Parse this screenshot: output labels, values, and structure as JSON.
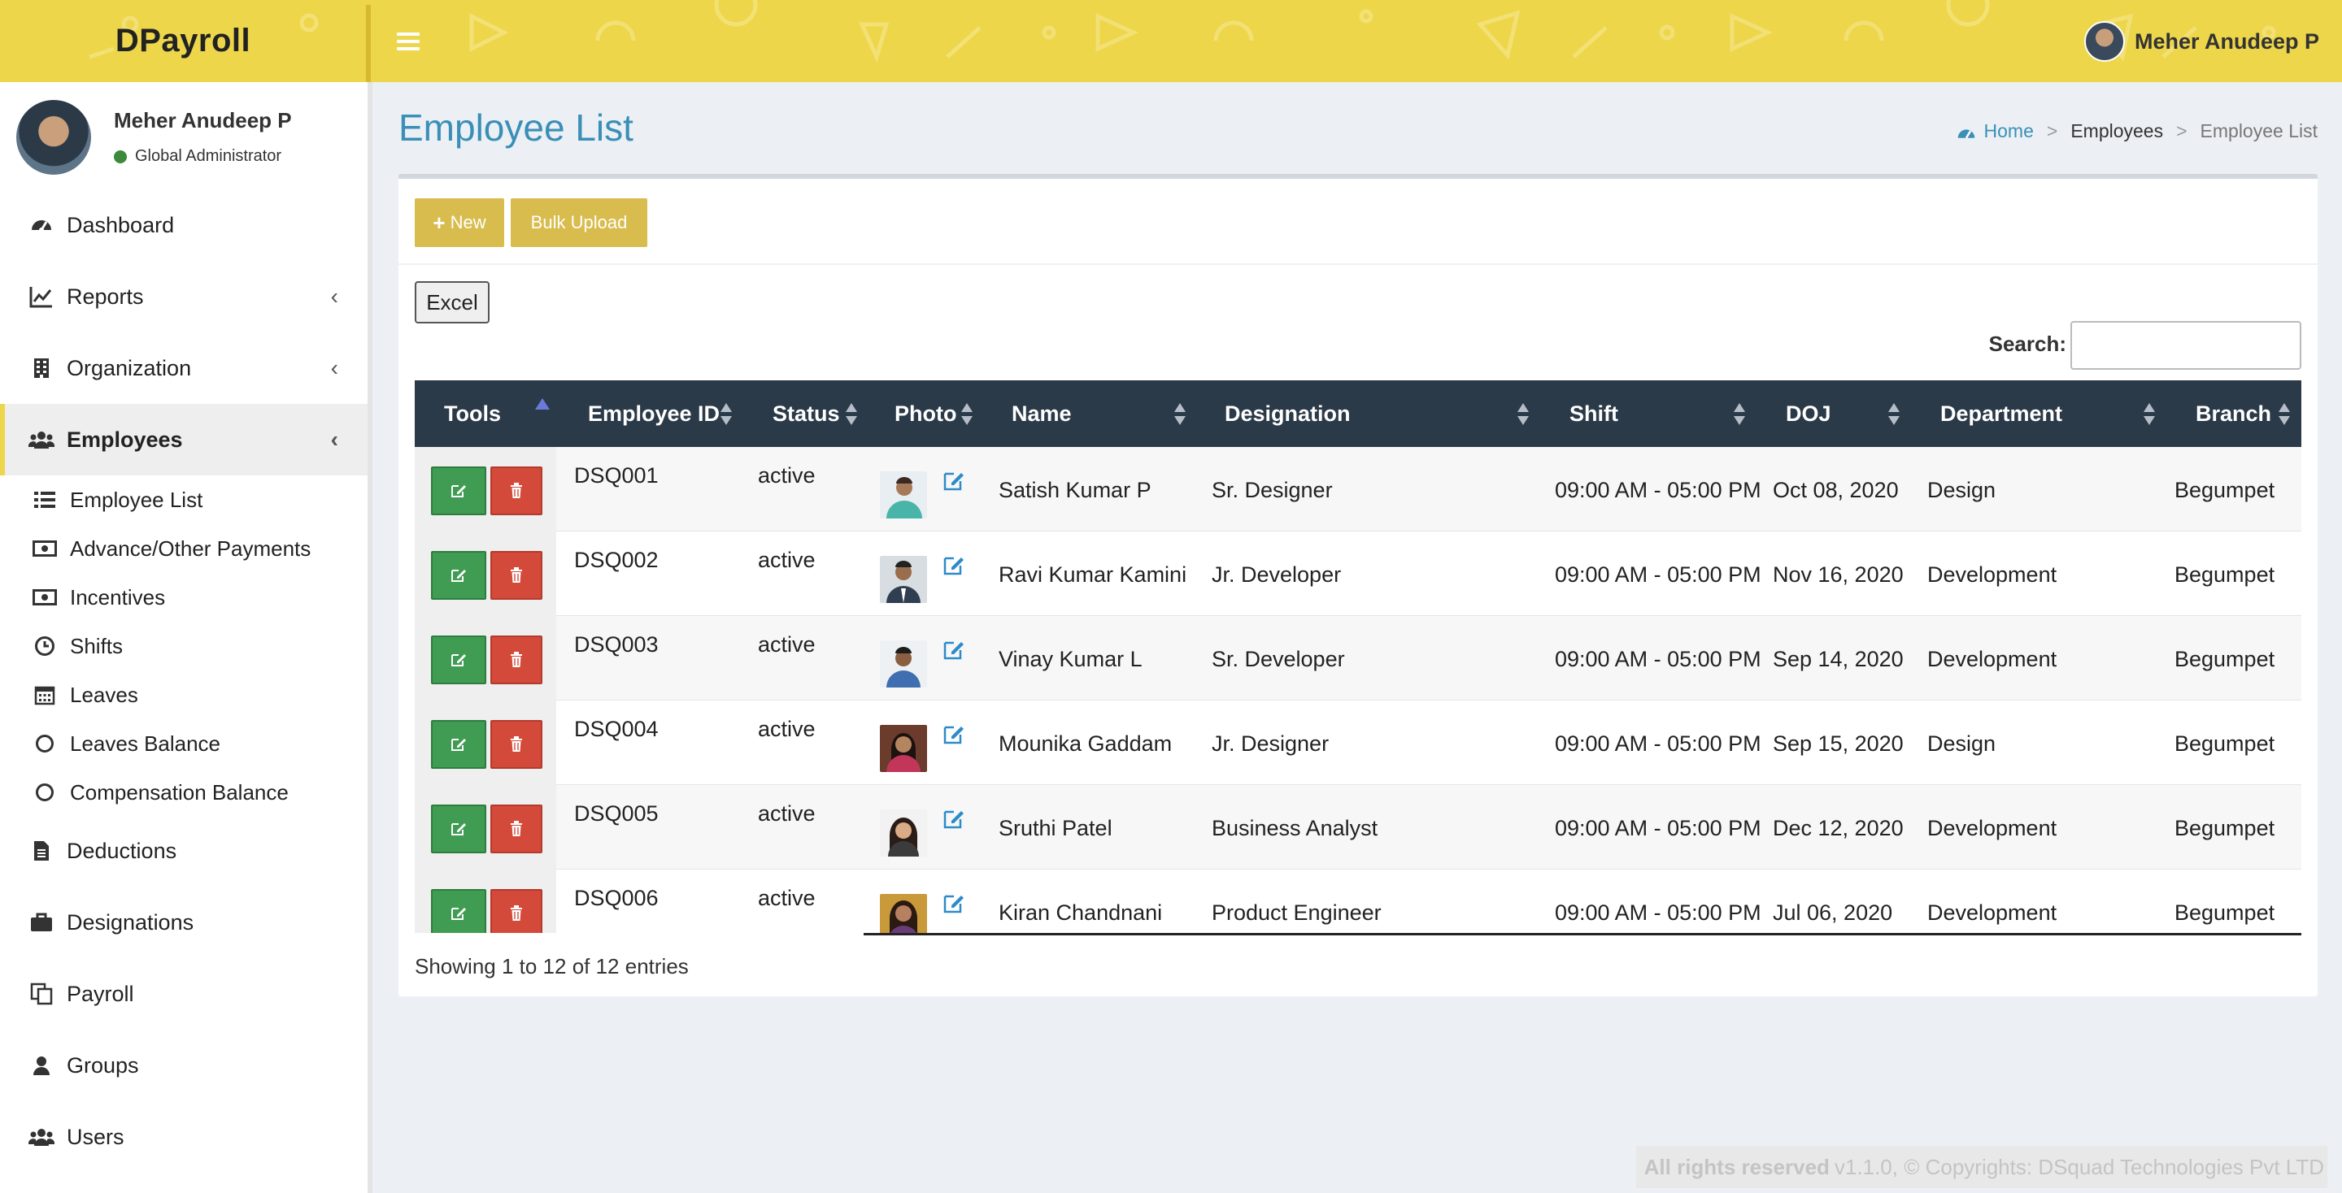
{
  "header": {
    "logo": "DPayroll",
    "user_name": "Meher Anudeep P"
  },
  "sidebar": {
    "profile": {
      "name": "Meher Anudeep P",
      "role": "Global Administrator",
      "status_color": "#3c8a3c"
    },
    "items": [
      {
        "label": "Dashboard",
        "icon": "dashboard-icon"
      },
      {
        "label": "Reports",
        "icon": "line-chart-icon"
      },
      {
        "label": "Organization",
        "icon": "building-icon"
      },
      {
        "label": "Employees",
        "icon": "users-icon"
      },
      {
        "label": "Deductions",
        "icon": "file-icon"
      },
      {
        "label": "Designations",
        "icon": "briefcase-icon"
      },
      {
        "label": "Payroll",
        "icon": "copy-icon"
      },
      {
        "label": "Groups",
        "icon": "user-icon"
      },
      {
        "label": "Users",
        "icon": "users-icon"
      }
    ],
    "sub_items": [
      {
        "label": "Employee List",
        "icon": "list-icon"
      },
      {
        "label": "Advance/Other Payments",
        "icon": "money-icon"
      },
      {
        "label": "Incentives",
        "icon": "money-icon"
      },
      {
        "label": "Shifts",
        "icon": "clock-icon"
      },
      {
        "label": "Leaves",
        "icon": "calendar-icon"
      },
      {
        "label": "Leaves Balance",
        "icon": "circle-icon"
      },
      {
        "label": "Compensation Balance",
        "icon": "circle-icon"
      }
    ]
  },
  "page": {
    "title": "Employee List",
    "breadcrumb": {
      "home": "Home",
      "section": "Employees",
      "current": "Employee List"
    }
  },
  "toolbar": {
    "new_label": "New",
    "bulk_upload_label": "Bulk Upload",
    "excel_label": "Excel",
    "search_label": "Search:",
    "search_value": ""
  },
  "table": {
    "columns": [
      "Tools",
      "Employee ID",
      "Status",
      "Photo",
      "Name",
      "Designation",
      "Shift",
      "DOJ",
      "Department",
      "Branch"
    ],
    "rows": [
      {
        "id": "DSQ001",
        "status": "active",
        "name": "Satish Kumar P",
        "designation": "Sr. Designer",
        "shift": "09:00 AM - 05:00 PM",
        "doj": "Oct 08, 2020",
        "department": "Design",
        "branch": "Begumpet"
      },
      {
        "id": "DSQ002",
        "status": "active",
        "name": "Ravi Kumar Kamini",
        "designation": "Jr. Developer",
        "shift": "09:00 AM - 05:00 PM",
        "doj": "Nov 16, 2020",
        "department": "Development",
        "branch": "Begumpet"
      },
      {
        "id": "DSQ003",
        "status": "active",
        "name": "Vinay Kumar L",
        "designation": "Sr. Developer",
        "shift": "09:00 AM - 05:00 PM",
        "doj": "Sep 14, 2020",
        "department": "Development",
        "branch": "Begumpet"
      },
      {
        "id": "DSQ004",
        "status": "active",
        "name": "Mounika Gaddam",
        "designation": "Jr. Designer",
        "shift": "09:00 AM - 05:00 PM",
        "doj": "Sep 15, 2020",
        "department": "Design",
        "branch": "Begumpet"
      },
      {
        "id": "DSQ005",
        "status": "active",
        "name": "Sruthi Patel",
        "designation": "Business Analyst",
        "shift": "09:00 AM - 05:00 PM",
        "doj": "Dec 12, 2020",
        "department": "Development",
        "branch": "Begumpet"
      },
      {
        "id": "DSQ006",
        "status": "active",
        "name": "Kiran Chandnani",
        "designation": "Product Engineer",
        "shift": "09:00 AM - 05:00 PM",
        "doj": "Jul 06, 2020",
        "department": "Development",
        "branch": "Begumpet"
      }
    ],
    "info": "Showing 1 to 12 of 12 entries"
  },
  "footer": {
    "rights": "All rights reserved",
    "copyright": "v1.1.0, © Copyrights: DSquad Technologies Pvt LTD"
  },
  "colors": {
    "header_bg": "#edd64a",
    "accent_blue": "#3a8fb7",
    "table_header": "#2b3a48",
    "edit_green": "#3f9c52",
    "delete_red": "#d44a3a",
    "button_yellow": "#d8bc4d"
  }
}
